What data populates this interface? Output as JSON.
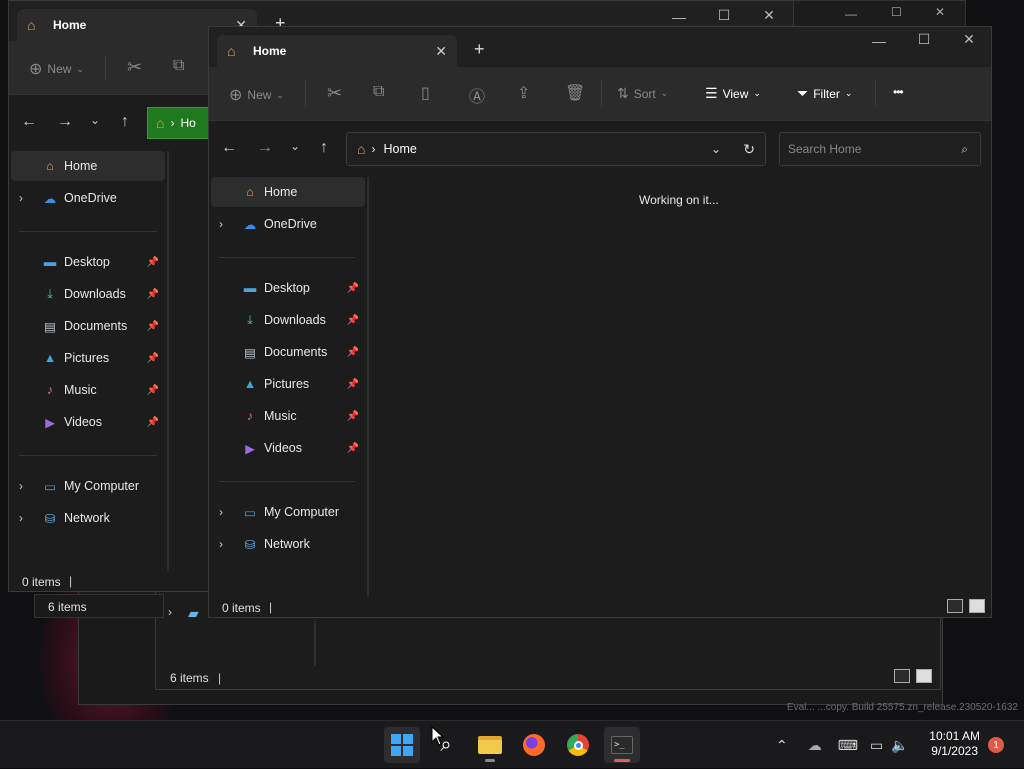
{
  "back_window": {
    "tab_title": "Home",
    "toolbar": {
      "new_label": "New"
    },
    "address": {
      "location": "Ho"
    },
    "sidebar": {
      "items": [
        {
          "label": "Home",
          "icon": "home-icon",
          "selected": true
        },
        {
          "label": "OneDrive",
          "icon": "onedrive-icon",
          "expandable": true
        },
        {
          "label": "Desktop",
          "icon": "desktop-icon",
          "pinned": true
        },
        {
          "label": "Downloads",
          "icon": "downloads-icon",
          "pinned": true
        },
        {
          "label": "Documents",
          "icon": "documents-icon",
          "pinned": true
        },
        {
          "label": "Pictures",
          "icon": "pictures-icon",
          "pinned": true
        },
        {
          "label": "Music",
          "icon": "music-icon",
          "pinned": true
        },
        {
          "label": "Videos",
          "icon": "videos-icon",
          "pinned": true
        },
        {
          "label": "My Computer",
          "icon": "computer-icon",
          "expandable": true
        },
        {
          "label": "Network",
          "icon": "network-icon",
          "expandable": true
        }
      ]
    },
    "status": "0 items"
  },
  "under_windows": {
    "status_a": "6 items",
    "status_b": "6 items"
  },
  "front_window": {
    "tab_title": "Home",
    "toolbar": {
      "new_label": "New",
      "sort_label": "Sort",
      "view_label": "View",
      "filter_label": "Filter",
      "more_label": "•••"
    },
    "address": {
      "location": "Home"
    },
    "search": {
      "placeholder": "Search Home"
    },
    "sidebar": {
      "items": [
        {
          "label": "Home",
          "icon": "home-icon",
          "selected": true
        },
        {
          "label": "OneDrive",
          "icon": "onedrive-icon",
          "expandable": true
        },
        {
          "label": "Desktop",
          "icon": "desktop-icon",
          "pinned": true
        },
        {
          "label": "Downloads",
          "icon": "downloads-icon",
          "pinned": true
        },
        {
          "label": "Documents",
          "icon": "documents-icon",
          "pinned": true
        },
        {
          "label": "Pictures",
          "icon": "pictures-icon",
          "pinned": true
        },
        {
          "label": "Music",
          "icon": "music-icon",
          "pinned": true
        },
        {
          "label": "Videos",
          "icon": "videos-icon",
          "pinned": true
        },
        {
          "label": "My Computer",
          "icon": "computer-icon",
          "expandable": true
        },
        {
          "label": "Network",
          "icon": "network-icon",
          "expandable": true
        }
      ]
    },
    "content_message": "Working on it...",
    "status": "0 items"
  },
  "watermark": "Eval... ...copy. Build 25575.zn_release.230520-1632",
  "taskbar": {
    "apps": [
      {
        "name": "start",
        "icon": "windows-start-icon"
      },
      {
        "name": "search",
        "icon": "search-icon"
      },
      {
        "name": "file-explorer",
        "icon": "file-explorer-icon",
        "running": true
      },
      {
        "name": "firefox",
        "icon": "firefox-icon"
      },
      {
        "name": "chrome",
        "icon": "chrome-icon"
      },
      {
        "name": "terminal",
        "icon": "terminal-icon",
        "running": true,
        "active": true
      }
    ],
    "time": "10:01 AM",
    "date": "9/1/2023",
    "notification_count": "1"
  },
  "colors": {
    "home_icon": "#e8a35a",
    "onedrive": "#3a8ee6",
    "accent_green": "#1f7a1f",
    "badge": "#e05a45"
  }
}
